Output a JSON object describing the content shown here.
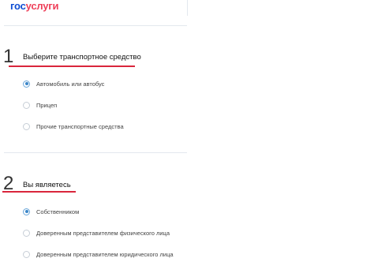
{
  "header": {
    "logo_gos": "гос",
    "logo_uslugi": "услуги"
  },
  "steps": [
    {
      "number": "1",
      "title": "Выберите транспортное средство",
      "options": [
        {
          "label": "Автомобиль или автобус",
          "checked": true
        },
        {
          "label": "Прицеп",
          "checked": false
        },
        {
          "label": "Прочие транспортные средства",
          "checked": false
        }
      ]
    },
    {
      "number": "2",
      "title": "Вы являетесь",
      "options": [
        {
          "label": "Собственником",
          "checked": true
        },
        {
          "label": "Доверенным представителем физического лица",
          "checked": false
        },
        {
          "label": "Доверенным представителем юридического лица",
          "checked": false
        }
      ]
    }
  ],
  "colors": {
    "accent_blue": "#0d4cd3",
    "accent_red": "#ee3f58",
    "underline_red": "#d9263c",
    "radio_blue": "#3b86c8"
  }
}
